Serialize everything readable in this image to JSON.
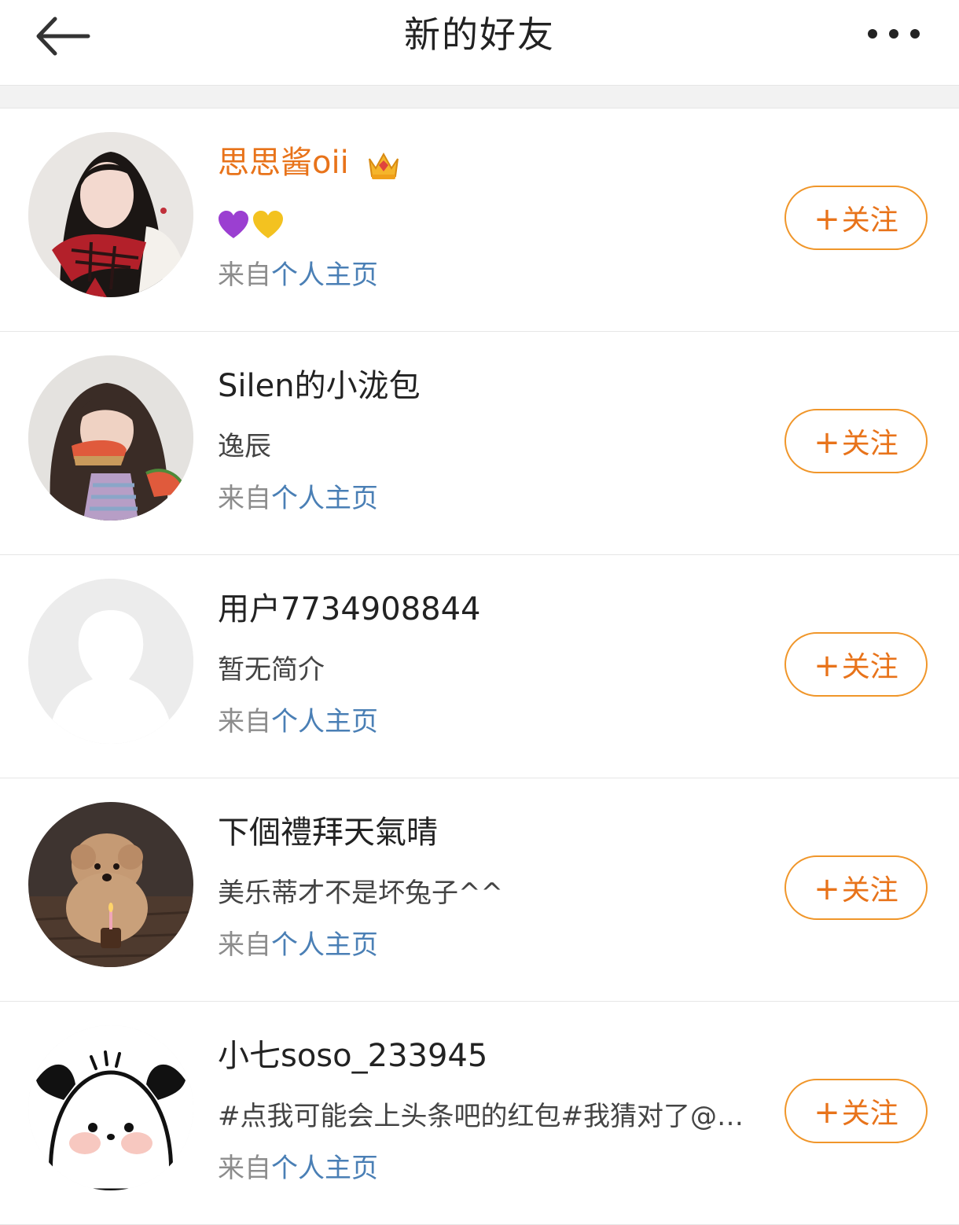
{
  "header": {
    "title": "新的好友",
    "back_icon": "arrow-left-icon",
    "more_icon": "more-dots-icon"
  },
  "colors": {
    "accent": "#e8731a",
    "link": "#4a7fb5",
    "muted": "#8c8c8c",
    "divider": "#e6e6e6"
  },
  "follow_label": "关注",
  "follow_prefix": "+",
  "source_prefix": "来自",
  "source_link": "个人主页",
  "friends": [
    {
      "name": "思思酱oii",
      "vip": true,
      "badge_icon": "crown-icon",
      "desc": "",
      "desc_emoji": [
        "purple-heart-icon",
        "yellow-heart-icon"
      ],
      "avatar": "photo-girl-red-scarf"
    },
    {
      "name": "Silen的小泷包",
      "vip": false,
      "desc": "逸辰",
      "avatar": "photo-child-watermelon"
    },
    {
      "name": "用户7734908844",
      "vip": false,
      "desc": "暂无简介",
      "avatar": "default-avatar-icon"
    },
    {
      "name": "下個禮拜天氣晴",
      "vip": false,
      "desc": "美乐蒂才不是坏兔子^^",
      "avatar": "photo-poodle-candle"
    },
    {
      "name": "小七soso_233945",
      "vip": false,
      "desc": "#点我可能会上头条吧的红包#我猜对了@…",
      "avatar": "cartoon-pochacco"
    }
  ]
}
